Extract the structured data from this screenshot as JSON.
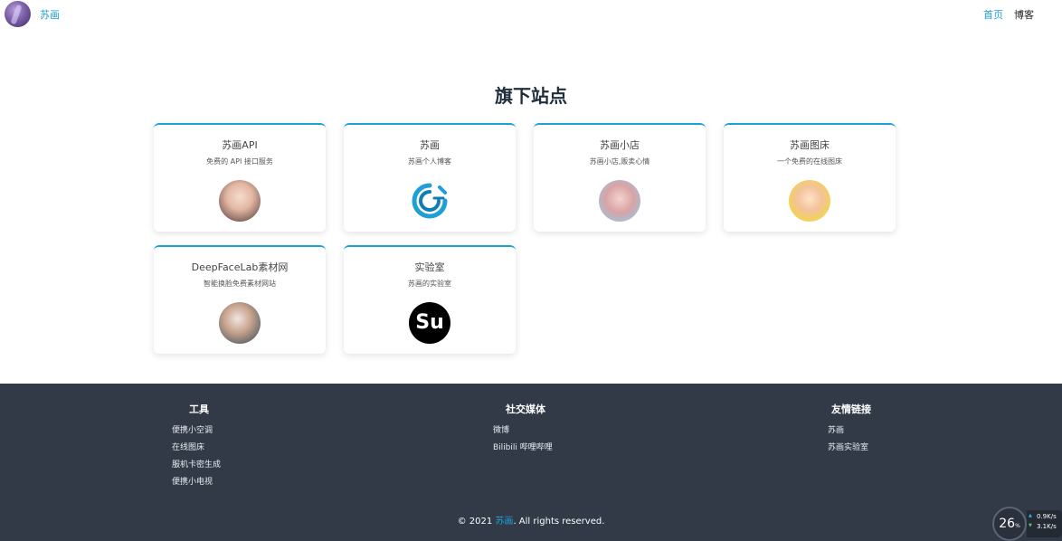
{
  "header": {
    "brand": "苏画",
    "nav": [
      "首页",
      "博客"
    ]
  },
  "section_title": "旗下站点",
  "cards": [
    {
      "title": "苏画API",
      "desc": "免费的 API 接口服务",
      "icon": "portrait-girl-icon"
    },
    {
      "title": "苏画",
      "desc": "苏画个人博客",
      "icon": "swirl-logo-icon"
    },
    {
      "title": "苏画小店",
      "desc": "苏画小店,贩卖心情",
      "icon": "portrait-girl-icon"
    },
    {
      "title": "苏画图床",
      "desc": "一个免费的在线图床",
      "icon": "portrait-girl-icon"
    },
    {
      "title": "DeepFaceLab素材网",
      "desc": "智能换脸免费素材网站",
      "icon": "portrait-man-icon"
    },
    {
      "title": "实验室",
      "desc": "苏画的实验室",
      "icon": "su-logo-icon",
      "icon_text": "Su"
    }
  ],
  "footer": {
    "tools": {
      "heading": "工具",
      "items": [
        "便携小空调",
        "在线图床",
        "服机卡密生成",
        "便携小电视"
      ]
    },
    "social": {
      "heading": "社交媒体",
      "items": [
        "微博",
        "Bilibili 哔哩哔哩"
      ]
    },
    "friends": {
      "heading": "友情链接",
      "items": [
        "苏画",
        "苏画实验室"
      ]
    },
    "copyright_prefix": "© 2021 ",
    "copyright_name": "苏画",
    "copyright_suffix": ". All rights reserved."
  },
  "widget": {
    "percent": "26",
    "percent_unit": "%",
    "up": "0.9K/s",
    "down": "3.1K/s"
  },
  "colors": {
    "accent": "#1e9fd6",
    "footer_bg": "#323a47",
    "title": "#1f2d3d"
  }
}
